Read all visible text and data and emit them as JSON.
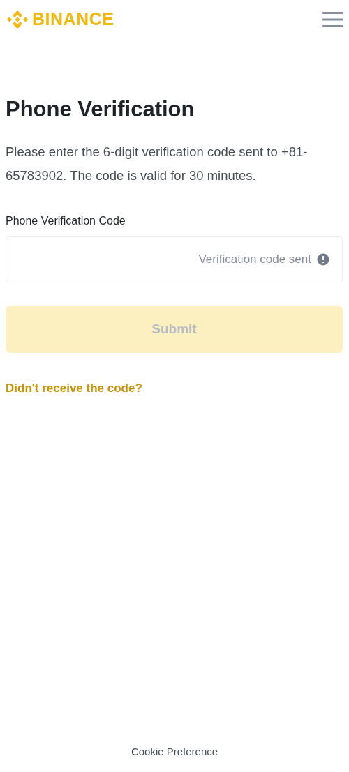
{
  "header": {
    "logo": "BINANCE"
  },
  "title": "Phone Verification",
  "description": "Please enter the 6-digit verification code sent to +81-65783902. The code is valid for 30 minutes.",
  "code_field": {
    "label": "Phone Verification Code",
    "status": "Verification code sent"
  },
  "submit": {
    "label": "Submit",
    "disabled": true
  },
  "resend_link": "Didn't receive the code?",
  "footer": {
    "link": "Cookie Preference"
  }
}
